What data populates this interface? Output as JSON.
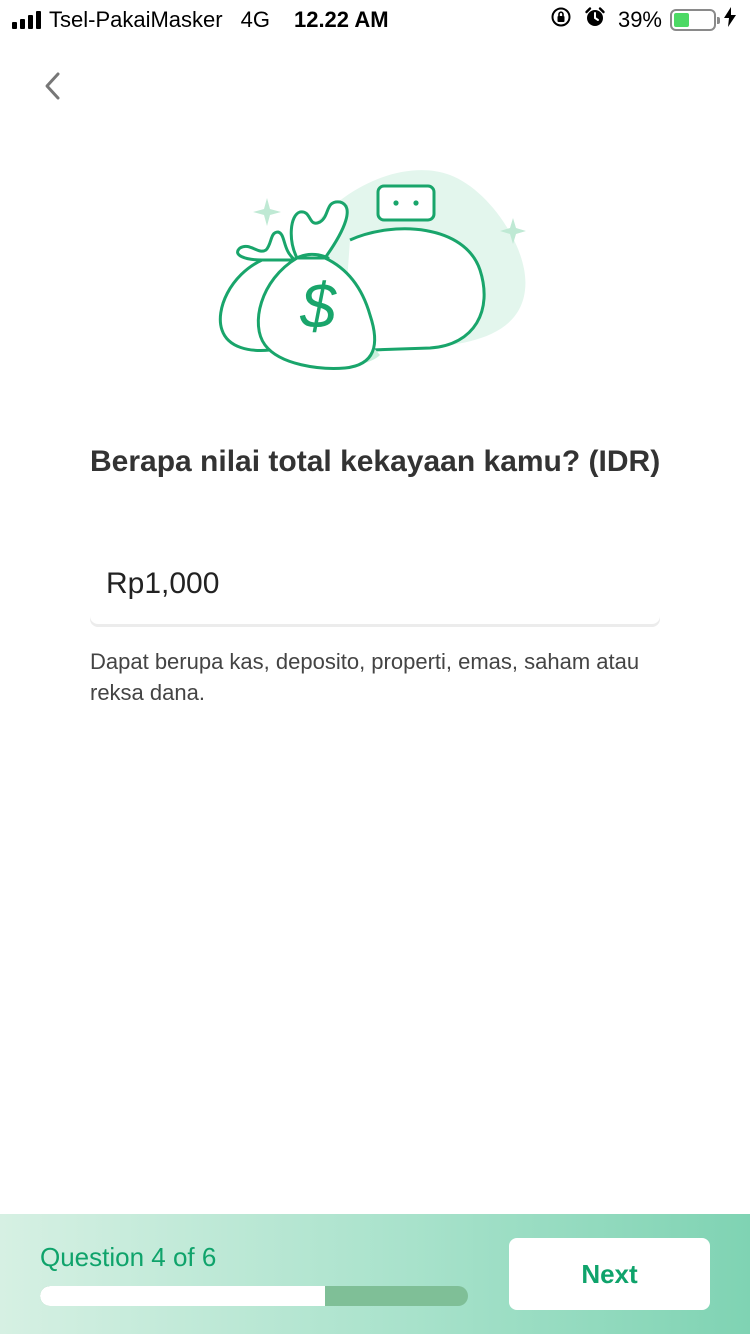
{
  "status_bar": {
    "carrier": "Tsel-PakaiMasker",
    "network": "4G",
    "time": "12.22 AM",
    "battery_percent": "39%",
    "battery_level": 0.39,
    "icons": [
      "signal-icon",
      "rotation-lock-icon",
      "alarm-icon",
      "battery-icon",
      "charging-icon"
    ]
  },
  "nav": {
    "back_icon": "chevron-left-icon"
  },
  "illustration": {
    "icon": "money-bags-illustration",
    "symbol": "$"
  },
  "question": {
    "title": "Berapa nilai total kekayaan kamu? (IDR)",
    "amount_value": "Rp1,000",
    "helper": "Dapat berupa kas, deposito, properti, emas, saham atau reksa dana."
  },
  "footer": {
    "progress_label": "Question 4 of 6",
    "progress_fraction": 0.667,
    "next_label": "Next"
  },
  "colors": {
    "accent": "#0fa36b",
    "illustration_stroke": "#19a56b",
    "illustration_fill": "#e3f6ed"
  }
}
